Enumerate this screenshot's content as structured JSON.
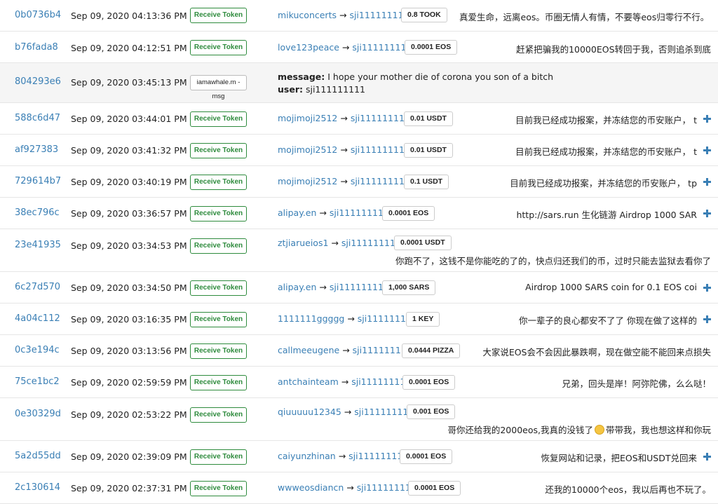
{
  "table": {
    "action_label": "Receive Token",
    "msg_action_label": "iamawhale.m - msg",
    "arrow": "→",
    "rows": [
      {
        "hash": "0b0736b4",
        "date": "Sep 09, 2020 04:13:36 PM",
        "from": "mikuconcerts",
        "to": "sji111111111",
        "amount": "0.8 TOOK",
        "memo": "真爱生命，远离eos。币圈无情人有情，不要等eos归零行不行。",
        "plus": false
      },
      {
        "hash": "b76fada8",
        "date": "Sep 09, 2020 04:12:51 PM",
        "from": "love123peace",
        "to": "sji111111111",
        "amount": "0.0001 EOS",
        "memo": "赶紧把骗我的10000EOS转回于我，否则追杀到底",
        "plus": false
      },
      {
        "hash": "804293e6",
        "date": "Sep 09, 2020 03:45:13 PM",
        "message_label": "message:",
        "message": "I hope your mother die of corona you son of a bitch",
        "user_label": "user:",
        "user": "sji111111111"
      },
      {
        "hash": "588c6d47",
        "date": "Sep 09, 2020 03:44:01 PM",
        "from": "mojimoji2512",
        "to": "sji111111111",
        "amount": "0.01 USDT",
        "memo": "目前我已经成功报案，并冻结您的币安账户， t",
        "plus": true
      },
      {
        "hash": "af927383",
        "date": "Sep 09, 2020 03:41:32 PM",
        "from": "mojimoji2512",
        "to": "sji111111111",
        "amount": "0.01 USDT",
        "memo": "目前我已经成功报案，并冻结您的币安账户， t",
        "plus": true
      },
      {
        "hash": "729614b7",
        "date": "Sep 09, 2020 03:40:19 PM",
        "from": "mojimoji2512",
        "to": "sji111111111",
        "amount": "0.1 USDT",
        "memo": "目前我已经成功报案，并冻结您的币安账户， tp",
        "plus": true
      },
      {
        "hash": "38ec796c",
        "date": "Sep 09, 2020 03:36:57 PM",
        "from": "alipay.en",
        "to": "sji111111111",
        "amount": "0.0001 EOS",
        "memo": "http://sars.run 生化链游 Airdrop 1000 SAR",
        "plus": true
      },
      {
        "hash": "23e41935",
        "date": "Sep 09, 2020 03:34:53 PM",
        "from": "ztjiarueios1",
        "to": "sji111111111",
        "amount": "0.0001 USDT",
        "memo": "你跑不了，这钱不是你能吃的了的，快点归还我们的币，过时只能去监狱去看你了",
        "plus": false
      },
      {
        "hash": "6c27d570",
        "date": "Sep 09, 2020 03:34:50 PM",
        "from": "alipay.en",
        "to": "sji111111111",
        "amount": "1,000 SARS",
        "memo": "Airdrop 1000 SARS coin for 0.1 EOS coi",
        "plus": true
      },
      {
        "hash": "4a04c112",
        "date": "Sep 09, 2020 03:16:35 PM",
        "from": "1111111ggggg",
        "to": "sji111111111",
        "amount": "1 KEY",
        "memo": "你一辈子的良心都安不了了 你现在做了这样的",
        "plus": true
      },
      {
        "hash": "0c3e194c",
        "date": "Sep 09, 2020 03:13:56 PM",
        "from": "callmeeugene",
        "to": "sji111111111",
        "amount": "0.0444 PIZZA",
        "memo": "大家说EOS会不会因此暴跌啊，现在做空能不能回来点损失",
        "plus": false
      },
      {
        "hash": "75ce1bc2",
        "date": "Sep 09, 2020 02:59:59 PM",
        "from": "antchainteam",
        "to": "sji111111111",
        "amount": "0.0001 EOS",
        "memo": "兄弟，回头是岸！阿弥陀佛，么么哒！",
        "plus": false
      },
      {
        "hash": "0e30329d",
        "date": "Sep 09, 2020 02:53:22 PM",
        "from": "qiuuuuu12345",
        "to": "sji111111111",
        "amount": "0.001 EOS",
        "memo_a": "哥你还给我的2000eos,我真的没钱了",
        "memo_b": "带带我，我也想这样和你玩",
        "plus": false
      },
      {
        "hash": "5a2d55dd",
        "date": "Sep 09, 2020 02:39:09 PM",
        "from": "caiyunzhinan",
        "to": "sji111111111",
        "amount": "0.0001 EOS",
        "memo": "恢复网站和记录，把EOS和USDT兑回来",
        "plus": true
      },
      {
        "hash": "2c130614",
        "date": "Sep 09, 2020 02:37:31 PM",
        "from": "wwweosdiancn",
        "to": "sji111111111",
        "amount": "0.0001 EOS",
        "memo": "还我的10000个eos，我以后再也不玩了。",
        "plus": false
      }
    ]
  }
}
